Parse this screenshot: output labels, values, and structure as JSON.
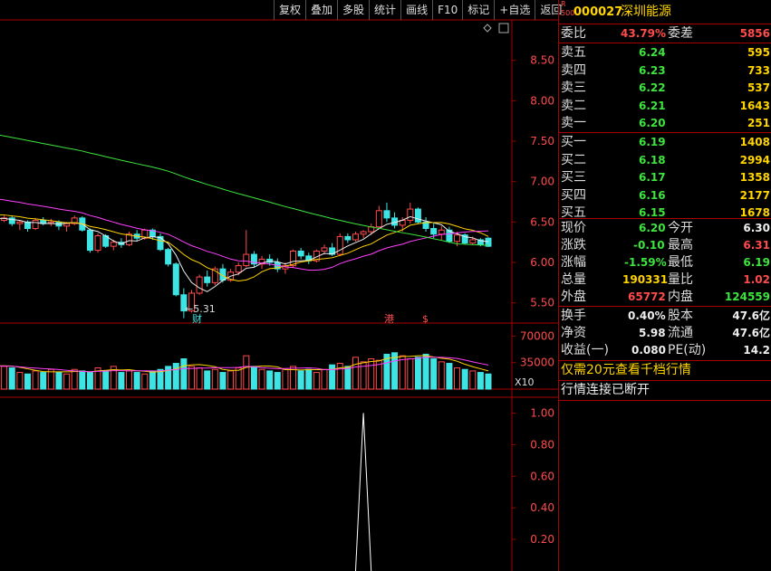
{
  "toolbar": {
    "items": [
      "复权",
      "叠加",
      "多股",
      "统计",
      "画线",
      "F10",
      "标记",
      "+自选",
      "返回"
    ]
  },
  "stock": {
    "badge_top": "R",
    "badge_bottom": "500",
    "code": "000027",
    "name": "深圳能源"
  },
  "commission": {
    "ratio_label": "委比",
    "ratio": "43.79%",
    "diff_label": "委差",
    "diff": "5856"
  },
  "asks": [
    {
      "label": "卖五",
      "price": "6.24",
      "vol": "595"
    },
    {
      "label": "卖四",
      "price": "6.23",
      "vol": "733"
    },
    {
      "label": "卖三",
      "price": "6.22",
      "vol": "537"
    },
    {
      "label": "卖二",
      "price": "6.21",
      "vol": "1643"
    },
    {
      "label": "卖一",
      "price": "6.20",
      "vol": "251"
    }
  ],
  "bids": [
    {
      "label": "买一",
      "price": "6.19",
      "vol": "1408"
    },
    {
      "label": "买二",
      "price": "6.18",
      "vol": "2994"
    },
    {
      "label": "买三",
      "price": "6.17",
      "vol": "1358"
    },
    {
      "label": "买四",
      "price": "6.16",
      "vol": "2177"
    },
    {
      "label": "买五",
      "price": "6.15",
      "vol": "1678"
    }
  ],
  "quote": {
    "now_label": "现价",
    "now": "6.20",
    "open_label": "今开",
    "open": "6.30",
    "chg_label": "涨跌",
    "chg": "-0.10",
    "high_label": "最高",
    "high": "6.31",
    "pct_label": "涨幅",
    "pct": "-1.59%",
    "low_label": "最低",
    "low": "6.19",
    "vol_label": "总量",
    "vol": "190331",
    "vr_label": "量比",
    "vr": "1.02",
    "outer_label": "外盘",
    "outer": "65772",
    "inner_label": "内盘",
    "inner": "124559"
  },
  "fundamentals": {
    "turnover_label": "换手",
    "turnover": "0.40%",
    "equity_label": "股本",
    "equity": "47.6亿",
    "nav_label": "净资",
    "nav": "5.98",
    "float_label": "流通",
    "float": "47.6亿",
    "eps_label": "收益(一)",
    "eps": "0.080",
    "pe_label": "PE(动)",
    "pe": "14.2"
  },
  "notices": {
    "upgrade": "仅需20元查看千档行情",
    "disconnected": "行情连接已断开"
  },
  "markers": {
    "low_annotation": "←5.31",
    "cai": "财",
    "gang": "港",
    "s": "$"
  },
  "chart_data": [
    {
      "type": "candlestick",
      "ylim": [
        5.25,
        9.0
      ],
      "y_ticks": [
        "8.50",
        "8.00",
        "7.50",
        "7.00",
        "6.50",
        "6.00",
        "5.50"
      ],
      "candles": [
        [
          6.55,
          6.6,
          6.48,
          6.52
        ],
        [
          6.52,
          6.58,
          6.5,
          6.55
        ],
        [
          6.55,
          6.57,
          6.45,
          6.48
        ],
        [
          6.48,
          6.52,
          6.4,
          6.5
        ],
        [
          6.5,
          6.52,
          6.38,
          6.42
        ],
        [
          6.42,
          6.55,
          6.4,
          6.52
        ],
        [
          6.52,
          6.56,
          6.46,
          6.48
        ],
        [
          6.48,
          6.54,
          6.45,
          6.5
        ],
        [
          6.5,
          6.52,
          6.4,
          6.45
        ],
        [
          6.45,
          6.5,
          6.38,
          6.48
        ],
        [
          6.48,
          6.58,
          6.46,
          6.55
        ],
        [
          6.55,
          6.57,
          6.38,
          6.4
        ],
        [
          6.4,
          6.42,
          6.12,
          6.15
        ],
        [
          6.15,
          6.36,
          6.12,
          6.33
        ],
        [
          6.33,
          6.35,
          6.18,
          6.2
        ],
        [
          6.2,
          6.28,
          6.15,
          6.25
        ],
        [
          6.25,
          6.3,
          6.18,
          6.22
        ],
        [
          6.22,
          6.38,
          6.2,
          6.35
        ],
        [
          6.35,
          6.4,
          6.26,
          6.3
        ],
        [
          6.3,
          6.42,
          6.28,
          6.4
        ],
        [
          6.4,
          6.42,
          6.28,
          6.32
        ],
        [
          6.32,
          6.36,
          6.14,
          6.16
        ],
        [
          6.16,
          6.18,
          5.95,
          5.98
        ],
        [
          5.98,
          6.0,
          5.58,
          5.6
        ],
        [
          5.6,
          5.68,
          5.31,
          5.4
        ],
        [
          5.4,
          5.66,
          5.38,
          5.62
        ],
        [
          5.62,
          5.85,
          5.6,
          5.82
        ],
        [
          5.82,
          5.9,
          5.7,
          5.75
        ],
        [
          5.75,
          5.95,
          5.72,
          5.92
        ],
        [
          5.92,
          5.98,
          5.75,
          5.78
        ],
        [
          5.78,
          5.92,
          5.76,
          5.88
        ],
        [
          5.88,
          6.0,
          5.84,
          5.96
        ],
        [
          5.96,
          6.4,
          5.94,
          6.1
        ],
        [
          6.1,
          6.14,
          5.94,
          5.98
        ],
        [
          5.98,
          6.08,
          5.92,
          6.04
        ],
        [
          6.04,
          6.1,
          5.96,
          6.0
        ],
        [
          6.0,
          6.05,
          5.88,
          5.92
        ],
        [
          5.92,
          6.0,
          5.86,
          5.96
        ],
        [
          5.96,
          6.16,
          5.94,
          6.14
        ],
        [
          6.14,
          6.18,
          6.04,
          6.08
        ],
        [
          6.08,
          6.12,
          5.98,
          6.02
        ],
        [
          6.02,
          6.16,
          6.0,
          6.14
        ],
        [
          6.14,
          6.22,
          6.1,
          6.18
        ],
        [
          6.18,
          6.24,
          6.08,
          6.1
        ],
        [
          6.1,
          6.36,
          6.08,
          6.32
        ],
        [
          6.32,
          6.36,
          6.24,
          6.28
        ],
        [
          6.28,
          6.38,
          6.26,
          6.35
        ],
        [
          6.35,
          6.4,
          6.3,
          6.38
        ],
        [
          6.38,
          6.48,
          6.34,
          6.44
        ],
        [
          6.44,
          6.7,
          6.42,
          6.64
        ],
        [
          6.64,
          6.74,
          6.5,
          6.55
        ],
        [
          6.55,
          6.62,
          6.42,
          6.46
        ],
        [
          6.46,
          6.56,
          6.38,
          6.52
        ],
        [
          6.52,
          6.74,
          6.48,
          6.66
        ],
        [
          6.66,
          6.68,
          6.48,
          6.5
        ],
        [
          6.5,
          6.56,
          6.38,
          6.42
        ],
        [
          6.42,
          6.48,
          6.3,
          6.35
        ],
        [
          6.35,
          6.45,
          6.28,
          6.4
        ],
        [
          6.4,
          6.44,
          6.24,
          6.26
        ],
        [
          6.26,
          6.38,
          6.2,
          6.34
        ],
        [
          6.34,
          6.36,
          6.22,
          6.24
        ],
        [
          6.24,
          6.32,
          6.22,
          6.28
        ],
        [
          6.28,
          6.3,
          6.2,
          6.22
        ],
        [
          6.3,
          6.31,
          6.19,
          6.2
        ]
      ]
    },
    {
      "type": "bar",
      "y_ticks": [
        "70000",
        "35000"
      ],
      "multiplier_label": "X10",
      "ylim": [
        0,
        80000
      ],
      "values": [
        34,
        30,
        28,
        22,
        20,
        24,
        22,
        26,
        22,
        20,
        26,
        24,
        22,
        28,
        24,
        30,
        22,
        24,
        22,
        20,
        24,
        26,
        30,
        34,
        40,
        30,
        28,
        24,
        26,
        22,
        24,
        28,
        44,
        30,
        26,
        24,
        22,
        26,
        30,
        24,
        26,
        22,
        26,
        32,
        34,
        30,
        42,
        36,
        40,
        38,
        46,
        48,
        44,
        40,
        42,
        46,
        40,
        36,
        34,
        28,
        26,
        24,
        22,
        20
      ],
      "up": [
        1,
        1,
        0,
        1,
        0,
        1,
        0,
        1,
        0,
        1,
        1,
        0,
        0,
        1,
        0,
        1,
        0,
        1,
        0,
        1,
        0,
        0,
        0,
        0,
        0,
        1,
        1,
        0,
        1,
        0,
        1,
        1,
        1,
        0,
        1,
        0,
        0,
        1,
        1,
        0,
        0,
        1,
        1,
        0,
        1,
        0,
        1,
        1,
        1,
        1,
        0,
        0,
        1,
        1,
        0,
        0,
        0,
        1,
        0,
        1,
        0,
        1,
        0,
        0
      ]
    },
    {
      "type": "line",
      "ylim": [
        0,
        1.1
      ],
      "y_ticks": [
        "1.00",
        "0.80",
        "0.60",
        "0.40",
        "0.20"
      ],
      "peak_index": 47,
      "peak_value": 1.0
    }
  ]
}
